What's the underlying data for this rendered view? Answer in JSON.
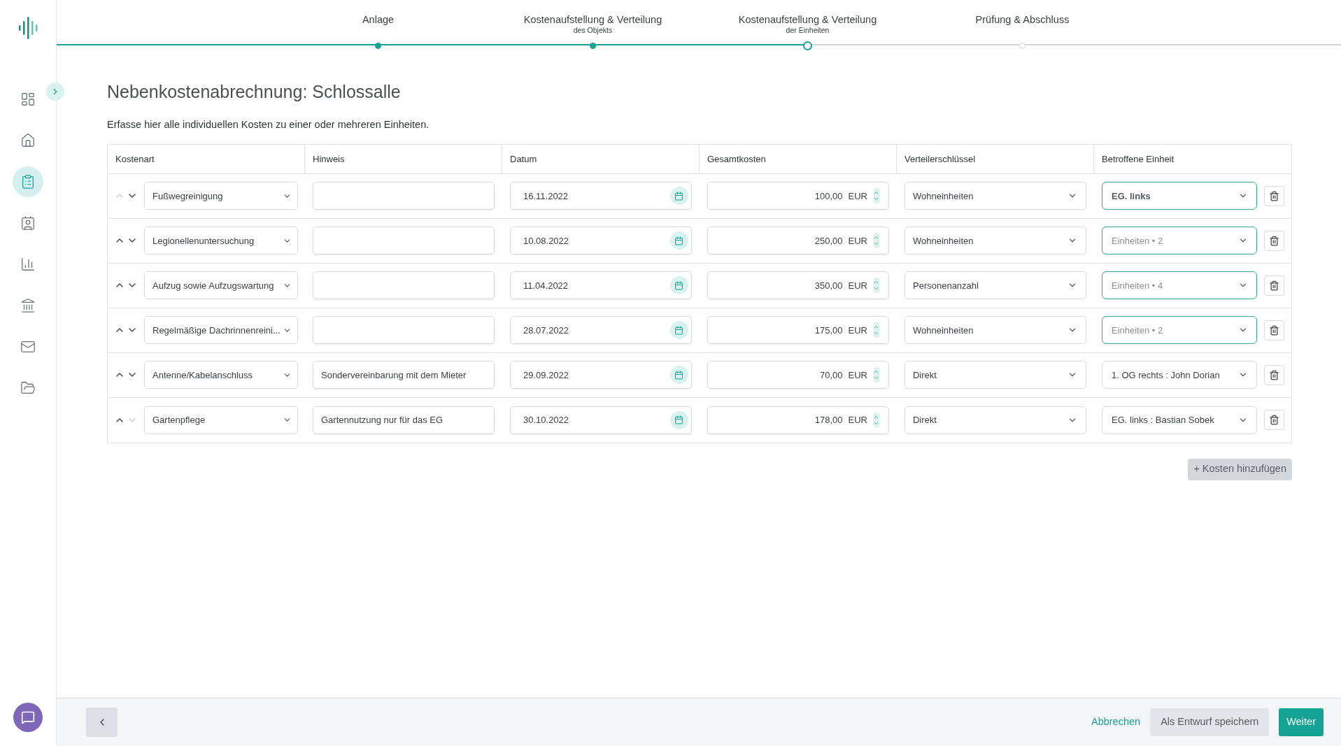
{
  "sidebar": {
    "items": [
      {
        "selected": false
      },
      {
        "selected": false
      },
      {
        "selected": true
      },
      {
        "selected": false
      },
      {
        "selected": false
      },
      {
        "selected": false
      },
      {
        "selected": false
      },
      {
        "selected": false
      }
    ]
  },
  "stepper": [
    {
      "label": "Anlage",
      "done": true,
      "current": false
    },
    {
      "label": "Kostenaufstellung & Verteilung",
      "sublabel": "des Objekts",
      "done": true,
      "current": false
    },
    {
      "label": "Kostenaufstellung & Verteilung",
      "sublabel": "der Einheiten",
      "done": false,
      "current": true
    },
    {
      "label": "Prüfung & Abschluss",
      "done": false,
      "current": false
    }
  ],
  "title": "Nebenkostenabrechnung: Schlossalle",
  "intro": "Erfasse hier alle individuellen Kosten zu einer oder mehreren Einheiten.",
  "table": {
    "columns": [
      "Kostenart",
      "Hinweis",
      "Datum",
      "Gesamtkosten",
      "Verteilerschlüssel",
      "Betroffene Einheit"
    ],
    "rows": [
      {
        "up_disabled": true,
        "down_disabled": false,
        "cost_type": "Fußwegreinigung",
        "note": "",
        "date": "16.11.2022",
        "amount": "100,00",
        "currency": "EUR",
        "key": "Wohneinheiten",
        "unit": "EG. links",
        "unit_muted": false,
        "unit_bold": true,
        "unit_highlighted": true
      },
      {
        "up_disabled": false,
        "down_disabled": false,
        "cost_type": "Legionellenuntersuchung",
        "note": "",
        "date": "10.08.2022",
        "amount": "250,00",
        "currency": "EUR",
        "key": "Wohneinheiten",
        "unit": "Einheiten • 2",
        "unit_muted": true,
        "unit_bold": false,
        "unit_highlighted": true
      },
      {
        "up_disabled": false,
        "down_disabled": false,
        "cost_type": "Aufzug sowie Aufzugswartung",
        "note": "",
        "date": "11.04.2022",
        "amount": "350,00",
        "currency": "EUR",
        "key": "Personenanzahl",
        "unit": "Einheiten • 4",
        "unit_muted": true,
        "unit_bold": false,
        "unit_highlighted": true
      },
      {
        "up_disabled": false,
        "down_disabled": false,
        "cost_type": "Regelmäßige Dachrinnenreini...",
        "note": "",
        "date": "28.07.2022",
        "amount": "175,00",
        "currency": "EUR",
        "key": "Wohneinheiten",
        "unit": "Einheiten • 2",
        "unit_muted": true,
        "unit_bold": false,
        "unit_highlighted": true
      },
      {
        "up_disabled": false,
        "down_disabled": false,
        "cost_type": "Antenne/Kabelanschluss",
        "note": "Sondervereinbarung mit dem Mieter",
        "date": "29.09.2022",
        "amount": "70,00",
        "currency": "EUR",
        "key": "Direkt",
        "unit": "1. OG rechts : John Dorian",
        "unit_muted": false,
        "unit_bold": false,
        "unit_highlighted": false
      },
      {
        "up_disabled": false,
        "down_disabled": true,
        "cost_type": "Gartenpflege",
        "note": "Gartennutzung nur für das EG",
        "date": "30.10.2022",
        "amount": "178,00",
        "currency": "EUR",
        "key": "Direkt",
        "unit": "EG. links : Bastian Sobek",
        "unit_muted": false,
        "unit_bold": false,
        "unit_highlighted": false
      }
    ]
  },
  "add_button": "+ Kosten hinzufügen",
  "footer": {
    "cancel": "Abbrechen",
    "draft": "Als Entwurf speichern",
    "next": "Weiter"
  }
}
